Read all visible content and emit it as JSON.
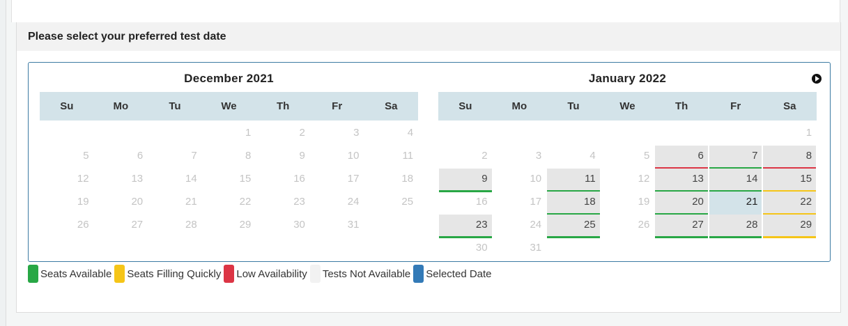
{
  "panel": {
    "title": "Please select your preferred test date"
  },
  "months": [
    {
      "title": "December 2021",
      "weekdays": [
        "Su",
        "Mo",
        "Tu",
        "We",
        "Th",
        "Fr",
        "Sa"
      ],
      "weeks": [
        [
          null,
          null,
          null,
          {
            "d": "1"
          },
          {
            "d": "2"
          },
          {
            "d": "3"
          },
          {
            "d": "4"
          }
        ],
        [
          {
            "d": "5"
          },
          {
            "d": "6"
          },
          {
            "d": "7"
          },
          {
            "d": "8"
          },
          {
            "d": "9"
          },
          {
            "d": "10"
          },
          {
            "d": "11"
          }
        ],
        [
          {
            "d": "12"
          },
          {
            "d": "13"
          },
          {
            "d": "14"
          },
          {
            "d": "15"
          },
          {
            "d": "16"
          },
          {
            "d": "17"
          },
          {
            "d": "18"
          }
        ],
        [
          {
            "d": "19"
          },
          {
            "d": "20"
          },
          {
            "d": "21"
          },
          {
            "d": "22"
          },
          {
            "d": "23"
          },
          {
            "d": "24"
          },
          {
            "d": "25"
          }
        ],
        [
          {
            "d": "26"
          },
          {
            "d": "27"
          },
          {
            "d": "28"
          },
          {
            "d": "29"
          },
          {
            "d": "30"
          },
          {
            "d": "31"
          },
          null
        ]
      ]
    },
    {
      "title": "January 2022",
      "weekdays": [
        "Su",
        "Mo",
        "Tu",
        "We",
        "Th",
        "Fr",
        "Sa"
      ],
      "weeks": [
        [
          null,
          null,
          null,
          null,
          null,
          null,
          {
            "d": "1"
          }
        ],
        [
          {
            "d": "2"
          },
          {
            "d": "3"
          },
          {
            "d": "4"
          },
          {
            "d": "5"
          },
          {
            "d": "6",
            "s": "low"
          },
          {
            "d": "7",
            "s": "available"
          },
          {
            "d": "8",
            "s": "low"
          }
        ],
        [
          {
            "d": "9",
            "s": "available"
          },
          {
            "d": "10"
          },
          {
            "d": "11",
            "s": "available"
          },
          {
            "d": "12"
          },
          {
            "d": "13",
            "s": "available"
          },
          {
            "d": "14",
            "s": "available"
          },
          {
            "d": "15",
            "s": "filling"
          }
        ],
        [
          {
            "d": "16"
          },
          {
            "d": "17"
          },
          {
            "d": "18",
            "s": "available"
          },
          {
            "d": "19"
          },
          {
            "d": "20",
            "s": "available"
          },
          {
            "d": "21",
            "s": "selected"
          },
          {
            "d": "22",
            "s": "filling"
          }
        ],
        [
          {
            "d": "23",
            "s": "available"
          },
          {
            "d": "24"
          },
          {
            "d": "25",
            "s": "available"
          },
          {
            "d": "26"
          },
          {
            "d": "27",
            "s": "available"
          },
          {
            "d": "28",
            "s": "available"
          },
          {
            "d": "29",
            "s": "filling"
          }
        ],
        [
          {
            "d": "30"
          },
          {
            "d": "31"
          },
          null,
          null,
          null,
          null,
          null
        ]
      ]
    }
  ],
  "legend": [
    {
      "label": "Seats Available",
      "color": "#28a745"
    },
    {
      "label": "Seats Filling Quickly",
      "color": "#f5c518"
    },
    {
      "label": "Low Availability",
      "color": "#dc3545"
    },
    {
      "label": "Tests Not Available",
      "color": "#f2f2f2"
    },
    {
      "label": "Selected Date",
      "color": "#337ab7"
    }
  ],
  "icons": {
    "next_month": "next-circle-icon"
  }
}
